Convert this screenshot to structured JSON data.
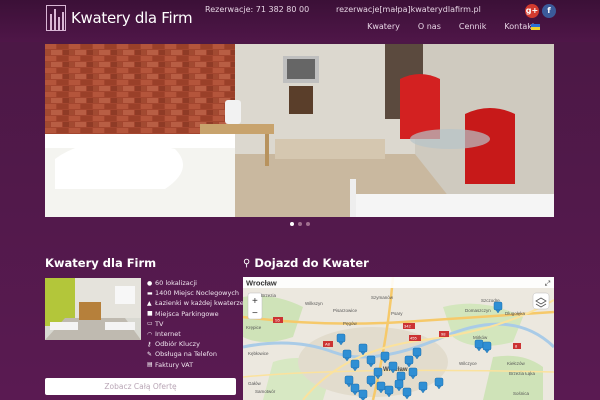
{
  "brand": {
    "name": "Kwatery dla Firm"
  },
  "contact": {
    "phone": "Rezerwacje: 71 382 80 00",
    "email": "rezerwacje[małpa]kwaterydlafirm.pl"
  },
  "social": {
    "gplus_icon": "g+",
    "facebook_icon": "f"
  },
  "nav": {
    "items": [
      "Kwatery",
      "O nas",
      "Cennik",
      "Kontakt"
    ]
  },
  "colors": {
    "bg": "#4a1844",
    "accent": "#5a1a52",
    "button": "#ffffff",
    "pin": "#2f8fd4"
  },
  "slider": {
    "total": 3,
    "active": 0
  },
  "about": {
    "title": "Kwatery dla Firm",
    "features": [
      {
        "icon": "globe-icon",
        "text": "60 lokalizacji"
      },
      {
        "icon": "bed-icon",
        "text": "1400 Miejsc Noclegowych"
      },
      {
        "icon": "drop-icon",
        "text": "Łazienki w każdej kwaterze"
      },
      {
        "icon": "parking-icon",
        "text": "Miejsca Parkingowe"
      },
      {
        "icon": "tv-icon",
        "text": "TV"
      },
      {
        "icon": "wifi-icon",
        "text": "Internet"
      },
      {
        "icon": "key-icon",
        "text": "Odbiór Kluczy"
      },
      {
        "icon": "wrench-icon",
        "text": "Obsługa na Telefon"
      },
      {
        "icon": "file-icon",
        "text": "Faktury VAT"
      }
    ],
    "button": "Zobacz Całą Ofertę"
  },
  "map_section": {
    "title": "Dojazd do Kwater",
    "map_title": "Wrocław",
    "zoom_in": "+",
    "zoom_out": "−",
    "labels": {
      "l1": "Brzezia",
      "l2": "Wilkszyn",
      "l3": "Szymanów",
      "l4": "Szczodre",
      "l5": "Pisarzowice",
      "l6": "Domaszczyn",
      "l7": "Pęgów",
      "l8": "Psary",
      "l9": "Mirków",
      "l10": "Kiełczów",
      "l11": "Wilczyce",
      "l12": "Brzezia Łąka",
      "l13": "Krępice",
      "l14": "Kębłowice",
      "l15": "Gałów",
      "l16": "Samotwór",
      "l17": "Dlugołęka",
      "l18": "Sośnica",
      "l19": "Wrocław",
      "r1": "S5",
      "r2": "342",
      "r3": "98",
      "r4": "455",
      "r5": "A8",
      "r6": "8"
    }
  }
}
